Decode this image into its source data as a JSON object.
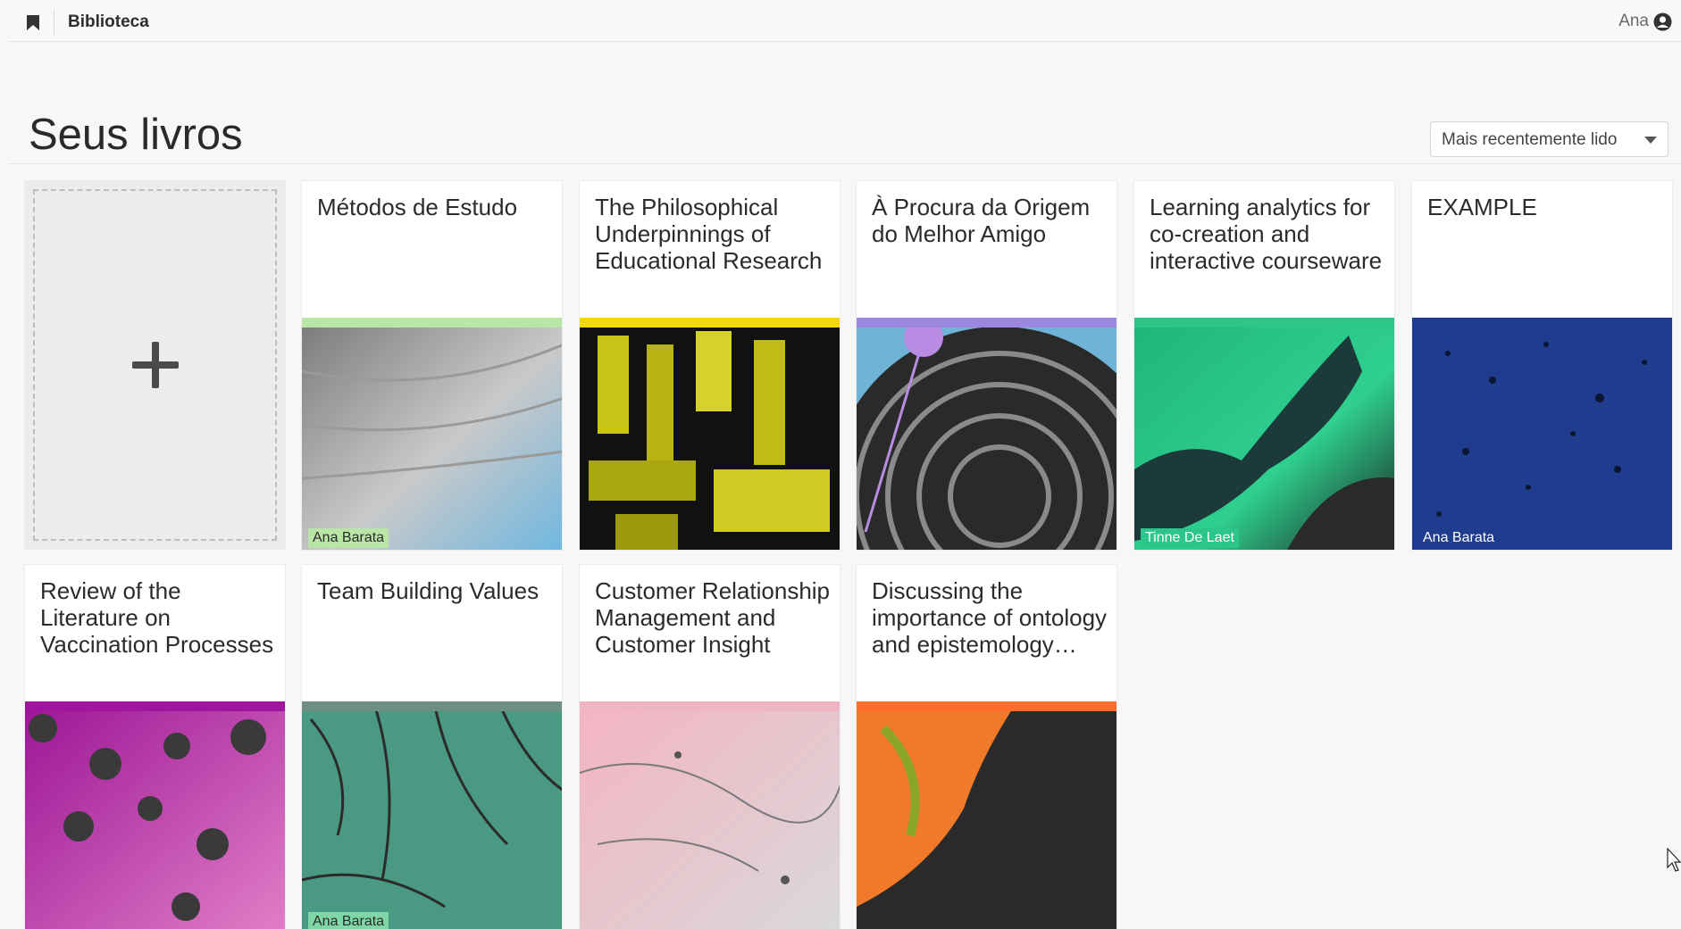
{
  "app": {
    "title": "Biblioteca",
    "user": "Ana"
  },
  "page": {
    "title": "Seus livros"
  },
  "sort": {
    "label": "Mais recentemente lido"
  },
  "books": [
    {
      "title": "Métodos de Estudo",
      "author": "Ana Barata",
      "strip": "#b9e6a6"
    },
    {
      "title": "The Philosophical Underpinnings of Educational Research",
      "author": "",
      "strip": "#f2d80b"
    },
    {
      "title": "À Procura da Origem do Melhor Amigo",
      "author": "",
      "strip": "#9b86e0"
    },
    {
      "title": "Learning analytics for co-creation and interactive courseware",
      "author": "Tinne De Laet",
      "strip": "#2cc58a"
    },
    {
      "title": "EXAMPLE",
      "author": "Ana Barata",
      "strip": "#1f3c8f"
    },
    {
      "title": "Review of the Literature on Vaccination Processes",
      "author": "",
      "strip": "#a0159e"
    },
    {
      "title": "Team Building Values",
      "author": "Ana Barata",
      "strip": "#6f8f85"
    },
    {
      "title": "Customer Relationship Management and Customer Insight",
      "author": "",
      "strip": "#f0b5c4"
    },
    {
      "title": "Discussing the importance of ontology and epistemology…",
      "author": "",
      "strip": "#ff6d2d"
    }
  ]
}
